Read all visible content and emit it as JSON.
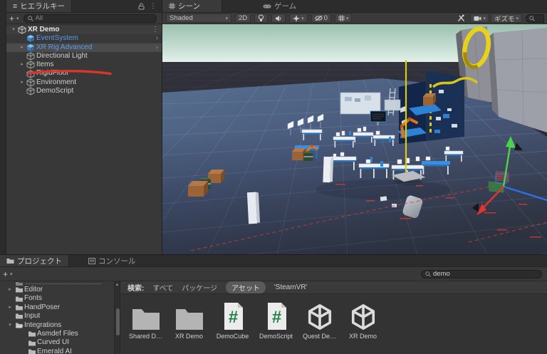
{
  "colors": {
    "prefab_text": "#5c9ce6",
    "annotation_red": "#d9362c",
    "gizmo_green": "#4cd24c",
    "gizmo_red": "#e23232",
    "gizmo_blue": "#2f6fe6",
    "script_icon_green": "#1e8449",
    "ring_yellow": "#e6d11b"
  },
  "icons": {
    "plus": "+",
    "caret": "▾",
    "kebab": "⋮",
    "chevron_right": "›",
    "fold_open": "▾",
    "fold_closed": "▸",
    "csharp_hash": "#",
    "scroll_up": "▲",
    "hierarchy_list": "≡"
  },
  "hierarchy": {
    "tab_label": "ヒエラルキー",
    "search_placeholder": "All",
    "scene_name": "XR Demo",
    "items": [
      {
        "label": "EventSystem",
        "type": "prefab"
      },
      {
        "label": "XR Rig Advanced",
        "type": "prefab",
        "highlighted": true,
        "annotated": true
      },
      {
        "label": "Directional Light",
        "type": "gameobject"
      },
      {
        "label": "Items",
        "type": "gameobject",
        "foldout": "collapsed"
      },
      {
        "label": "RigidFloor",
        "type": "gameobject"
      },
      {
        "label": "Environment",
        "type": "gameobject",
        "foldout": "collapsed"
      },
      {
        "label": "DemoScript",
        "type": "gameobject"
      }
    ]
  },
  "scene_view": {
    "tabs": [
      {
        "label": "シーン",
        "active": true
      },
      {
        "label": "ゲーム",
        "active": false
      }
    ],
    "toolbar": {
      "draw_mode": "Shaded",
      "toggle_2d": "2D",
      "hidden_count": "0",
      "gizmos_label": "ギズモ"
    }
  },
  "project": {
    "tabs": [
      {
        "label": "プロジェクト",
        "active": true
      },
      {
        "label": "コンソール",
        "active": false
      }
    ],
    "search_value": "demo",
    "filter": {
      "label": "検索:",
      "scopes": [
        {
          "label": "すべて",
          "active": false
        },
        {
          "label": "パッケージ",
          "active": false
        },
        {
          "label": "アセット",
          "active": true
        }
      ],
      "query": "'SteamVR'"
    },
    "folders": [
      {
        "label": "Editor",
        "depth": 1,
        "foldout": "collapsed"
      },
      {
        "label": "Fonts",
        "depth": 1
      },
      {
        "label": "HandPoser",
        "depth": 1,
        "foldout": "collapsed"
      },
      {
        "label": "Input",
        "depth": 1
      },
      {
        "label": "Integrations",
        "depth": 1,
        "foldout": "expanded"
      },
      {
        "label": "Asmdef Files",
        "depth": 2
      },
      {
        "label": "Curved UI",
        "depth": 2
      },
      {
        "label": "Emerald AI",
        "depth": 2
      }
    ],
    "assets": [
      {
        "label": "Shared D…",
        "type": "folder"
      },
      {
        "label": "XR Demo",
        "type": "folder"
      },
      {
        "label": "DemoCube",
        "type": "csharp-script"
      },
      {
        "label": "DemoScript",
        "type": "csharp-script"
      },
      {
        "label": "Quest De…",
        "type": "unity-asset"
      },
      {
        "label": "XR Demo",
        "type": "unity-asset"
      }
    ]
  }
}
